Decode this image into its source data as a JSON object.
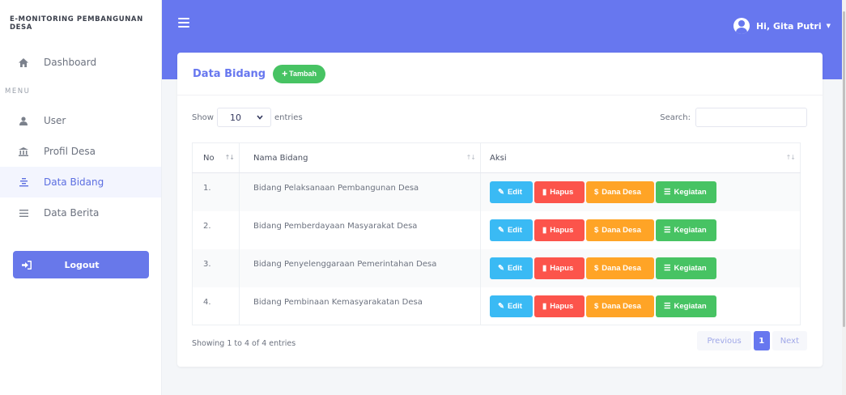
{
  "app": {
    "brand": "E-MONITORING PEMBANGUNAN DESA",
    "user_greeting": "Hi, Gita Putri",
    "accent": "#6777ef"
  },
  "sidebar": {
    "dashboard": {
      "label": "Dashboard",
      "icon": "home-icon"
    },
    "menu_heading": "MENU",
    "items": [
      {
        "label": "User",
        "icon": "user-icon"
      },
      {
        "label": "Profil Desa",
        "icon": "landmark-icon"
      },
      {
        "label": "Data Bidang",
        "icon": "list-icon",
        "active": true
      },
      {
        "label": "Data Berita",
        "icon": "bars-icon"
      }
    ],
    "logout": "Logout"
  },
  "card": {
    "title": "Data Bidang",
    "add_button": "Tambah",
    "show_label": "Show",
    "entries_value": "10",
    "entries_label": "entries",
    "search_label": "Search:",
    "search_value": ""
  },
  "table": {
    "headers": {
      "no": "No",
      "nama": "Nama Bidang",
      "aksi": "Aksi"
    },
    "rows": [
      {
        "no": "1.",
        "nama": "Bidang Pelaksanaan Pembangunan Desa"
      },
      {
        "no": "2.",
        "nama": "Bidang Pemberdayaan Masyarakat Desa"
      },
      {
        "no": "3.",
        "nama": "Bidang Penyelenggaraan Pemerintahan Desa"
      },
      {
        "no": "4.",
        "nama": "Bidang Pembinaan Kemasyarakatan Desa"
      }
    ],
    "actions": {
      "edit": "Edit",
      "hapus": "Hapus",
      "dana": "Dana Desa",
      "kegiatan": "Kegiatan"
    },
    "action_colors": {
      "edit": "#3abaf4",
      "hapus": "#fc544b",
      "dana": "#ffa426",
      "kegiatan": "#47c363"
    }
  },
  "footer": {
    "info": "Showing 1 to 4 of 4 entries",
    "previous": "Previous",
    "page": "1",
    "next": "Next"
  }
}
